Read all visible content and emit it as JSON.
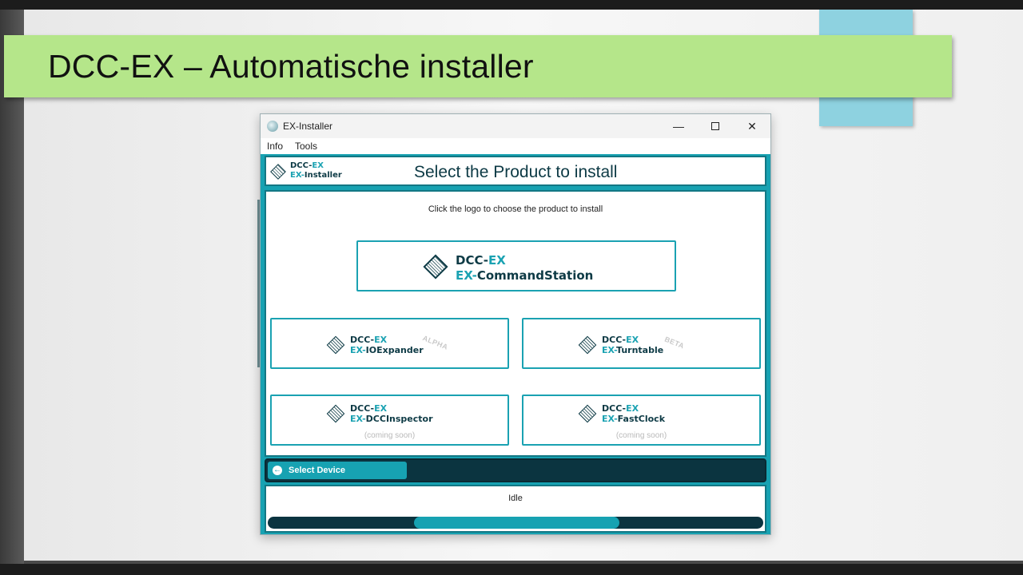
{
  "slide": {
    "title": "DCC-EX – Automatische installer"
  },
  "window": {
    "title": "EX-Installer",
    "controls": {
      "minimize": "—",
      "close": "✕"
    }
  },
  "menu": [
    "Info",
    "Tools"
  ],
  "header": {
    "logo_line1_a": "DCC-",
    "logo_line1_b": "EX",
    "logo_line2_a": "EX-",
    "logo_line2_b": "Installer",
    "title": "Select the Product to install"
  },
  "main": {
    "instruction": "Click the logo to choose the product to install",
    "products": [
      {
        "line1_a": "DCC-",
        "line1_b": "EX",
        "line2_a": "EX-",
        "line2_b": "CommandStation",
        "stamp": "",
        "note": ""
      },
      {
        "line1_a": "DCC-",
        "line1_b": "EX",
        "line2_a": "EX-",
        "line2_b": "IOExpander",
        "stamp": "ALPHA",
        "note": ""
      },
      {
        "line1_a": "DCC-",
        "line1_b": "EX",
        "line2_a": "EX-",
        "line2_b": "Turntable",
        "stamp": "BETA",
        "note": ""
      },
      {
        "line1_a": "DCC-",
        "line1_b": "EX",
        "line2_a": "EX-",
        "line2_b": "DCCInspector",
        "stamp": "",
        "note": "(coming soon)"
      },
      {
        "line1_a": "DCC-",
        "line1_b": "EX",
        "line2_a": "EX-",
        "line2_b": "FastClock",
        "stamp": "",
        "note": "(coming soon)"
      }
    ]
  },
  "nav": {
    "back_label": "Select Device"
  },
  "status": {
    "text": "Idle",
    "progress_start": 0.295,
    "progress_end": 0.71
  },
  "colors": {
    "accent": "#17a2b2",
    "dark": "#0b3440",
    "banner": "#b5e68a",
    "deco_blue": "#8ed2e0"
  }
}
